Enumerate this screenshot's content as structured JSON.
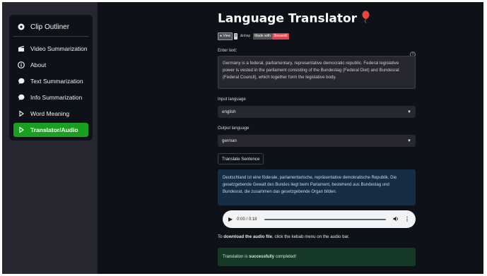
{
  "sidebar": {
    "header": {
      "label": "Clip Outliner",
      "icon": "chat-icon"
    },
    "items": [
      {
        "label": "Video Summarization",
        "icon": "clapperboard-icon"
      },
      {
        "label": "About",
        "icon": "info-icon"
      },
      {
        "label": "Text Summarization",
        "icon": "chat-bubble-icon"
      },
      {
        "label": "Info Summarization",
        "icon": "chat-bubble-icon"
      },
      {
        "label": "Word Meaning",
        "icon": "play-outline-icon"
      },
      {
        "label": "Translator/Audio",
        "icon": "play-outline-icon",
        "active": true
      }
    ]
  },
  "main": {
    "title": "Language Translator",
    "title_icon": "balloon-icon",
    "badges": [
      {
        "label": "View",
        "color": "#4b4f57"
      },
      {
        "label": "&nbsp",
        "color": "#0e1117"
      },
      {
        "label": "Made with",
        "color": "#555555"
      },
      {
        "label": "Streamlit",
        "color": "#e0444a"
      }
    ],
    "input_label": "Enter text:",
    "input_text": "Germany is a federal, parliamentary, representative democratic republic. Federal legislative power is vested in the parliament consisting of the Bundestag (Federal Diet) and Bundesrat (Federal Council), which together form the legislative body.",
    "input_language_label": "Input language",
    "input_language": "english",
    "output_language_label": "Output language",
    "output_language": "german",
    "translate_button": "Translate Sentence",
    "result_text": "Deutschland ist eine föderale, parlamentarische, repräsentative demokratische Republik. Die gesetzgebende Gewalt des Bundes liegt beim Parlament, bestehend aus Bundestag und Bundesrat, die zusammen das gesetzgebende Organ bilden.",
    "audio": {
      "time": "0:00 / 0:18"
    },
    "note": {
      "prefix": "To ",
      "bold": "download the audio file",
      "suffix": ", click the kebab menu on the audio bar."
    },
    "success": {
      "prefix": "Translation is ",
      "bold": "successfully",
      "suffix": " completed!"
    }
  },
  "colors": {
    "active_nav": "#19a021",
    "info_box": "#172d43",
    "success_box": "#173928"
  }
}
